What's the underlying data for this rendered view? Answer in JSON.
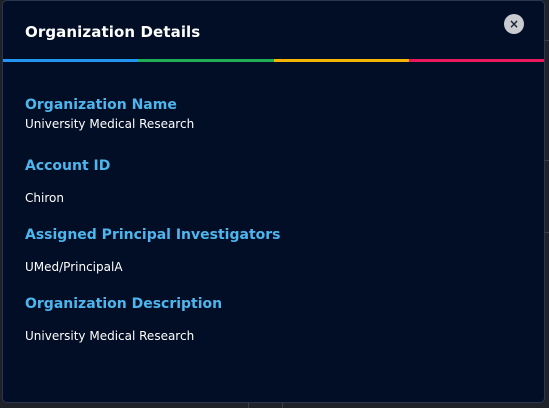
{
  "modal": {
    "title": "Organization Details",
    "close_icon_glyph": "×",
    "accent_colors": [
      "#2196f3",
      "#1fae55",
      "#f4b400",
      "#e8195f"
    ]
  },
  "fields": [
    {
      "label": "Organization Name",
      "value": "University Medical Research"
    },
    {
      "label": "Account ID",
      "value": "Chiron"
    },
    {
      "label": "Assigned Principal Investigators",
      "value": "UMed/PrincipalA"
    },
    {
      "label": "Organization Description",
      "value": "University Medical Research"
    }
  ]
}
